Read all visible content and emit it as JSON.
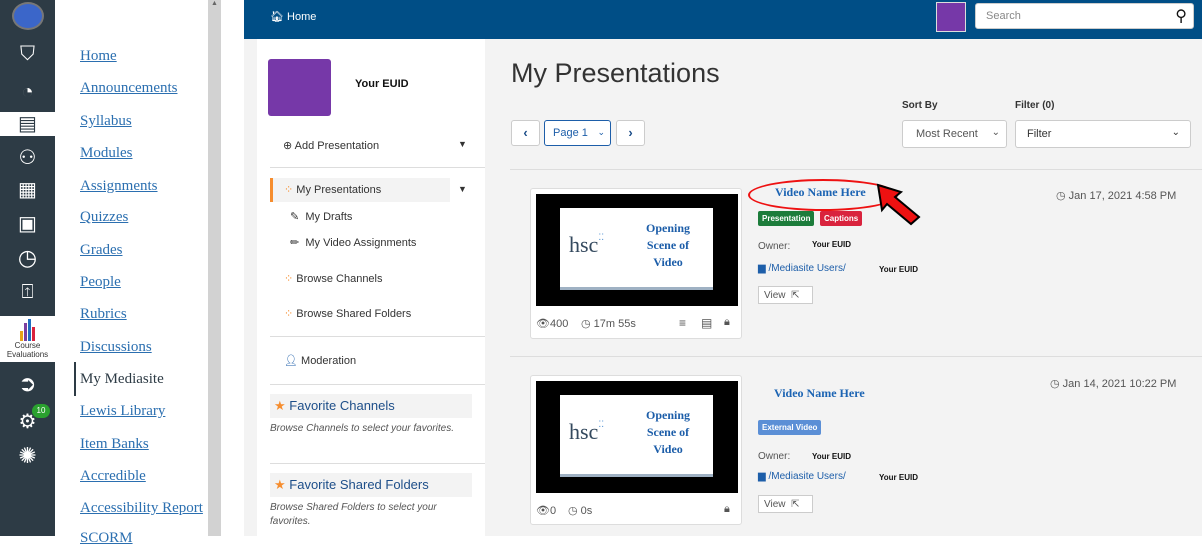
{
  "global_nav": {
    "course_eval_line1": "Course",
    "course_eval_line2": "Evaluations",
    "badge_count": "10"
  },
  "course_nav": {
    "items": [
      "Home",
      "Announcements",
      "Syllabus",
      "Modules",
      "Assignments",
      "Quizzes",
      "Grades",
      "People",
      "Rubrics",
      "Discussions",
      "My Mediasite",
      "Lewis Library",
      "Item Banks",
      "Accredible",
      "Accessibility Report",
      "SCORM"
    ],
    "active": "My Mediasite"
  },
  "topbar": {
    "home": "Home",
    "search_placeholder": "Search",
    "avatar_color": "#7638a8"
  },
  "profile": {
    "name": "Your EUID"
  },
  "sidebar": {
    "add_presentation": "Add Presentation",
    "my_presentations": "My Presentations",
    "my_drafts": "My Drafts",
    "my_video_assignments": "My Video Assignments",
    "browse_channels": "Browse Channels",
    "browse_shared_folders": "Browse Shared Folders",
    "moderation": "Moderation",
    "favorite_channels": "Favorite Channels",
    "favorite_channels_hint": "Browse Channels to select your favorites.",
    "favorite_shared_folders": "Favorite Shared Folders",
    "favorite_shared_folders_hint": "Browse Shared Folders to select your favorites."
  },
  "main": {
    "title": "My Presentations",
    "sort_by_label": "Sort By",
    "sort_by_value": "Most Recent",
    "filter_label": "Filter (0)",
    "filter_value": "Filter",
    "page_value": "Page 1"
  },
  "presentations": [
    {
      "name": "Video Name Here",
      "date": "Jan 17, 2021 4:58 PM",
      "badges": [
        "Presentation",
        "Captions"
      ],
      "owner_label": "Owner:",
      "owner": "Your EUID",
      "folder": "/Mediasite Users/",
      "folder_owner": "Your EUID",
      "view": "View",
      "views": "400",
      "duration": "17m 55s",
      "slide_logo": "hsc",
      "slide_title": "Opening Scene of Video"
    },
    {
      "name": "Video Name Here",
      "date": "Jan 14, 2021 10:22 PM",
      "badges": [
        "External Video"
      ],
      "owner_label": "Owner:",
      "owner": "Your EUID",
      "folder": "/Mediasite Users/",
      "folder_owner": "Your EUID",
      "view": "View",
      "views": "0",
      "duration": "0s",
      "slide_logo": "hsc",
      "slide_title": "Opening Scene of Video"
    }
  ],
  "colors": {
    "canvas_nav": "#2d3b45",
    "mediasite_blue": "#004e86",
    "orange": "#f68d2e",
    "badge_green": "#1c7c3b",
    "badge_red": "#d9233d",
    "badge_blue": "#5b8fd6",
    "annotation_red": "#e11"
  }
}
